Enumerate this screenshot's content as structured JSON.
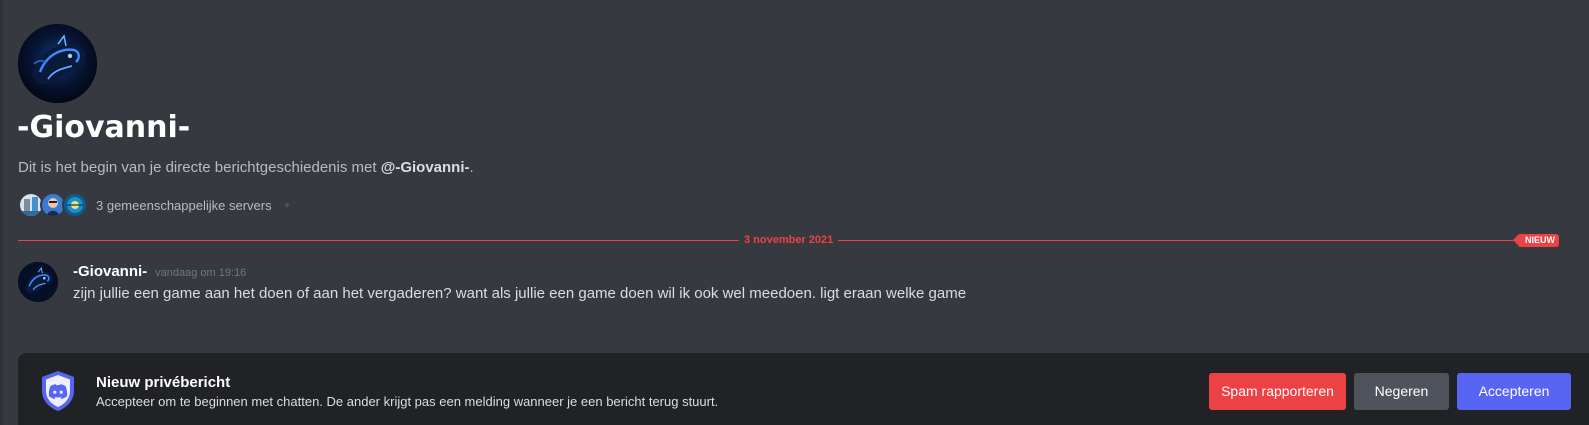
{
  "intro": {
    "username": "-Giovanni-",
    "description_prefix": "Dit is het begin van je directe berichtgeschiedenis met ",
    "description_mention": "@-Giovanni-",
    "description_suffix": ".",
    "mutual_servers_label": "3 gemeenschappelijke servers",
    "mutual_server_icons": [
      "server-icon-1",
      "server-icon-2",
      "server-icon-3"
    ]
  },
  "divider": {
    "date": "3 november 2021",
    "new_badge": "NIEUW",
    "color": "#ed4245"
  },
  "message": {
    "author": "-Giovanni-",
    "timestamp": "vandaag om 19:16",
    "text": "zijn jullie een game aan het doen of aan het vergaderen? want als jullie een game doen wil ik ook wel meedoen. ligt eraan welke game"
  },
  "request": {
    "title": "Nieuw privébericht",
    "subtitle": "Accepteer om te beginnen met chatten. De ander krijgt pas een melding wanneer je een bericht terug stuurt.",
    "buttons": {
      "spam": "Spam rapporteren",
      "ignore": "Negeren",
      "accept": "Accepteren"
    }
  },
  "colors": {
    "background": "#36393f",
    "bar": "#202225",
    "danger": "#ed4245",
    "brand": "#5865f2",
    "secondary": "#4f545c"
  }
}
